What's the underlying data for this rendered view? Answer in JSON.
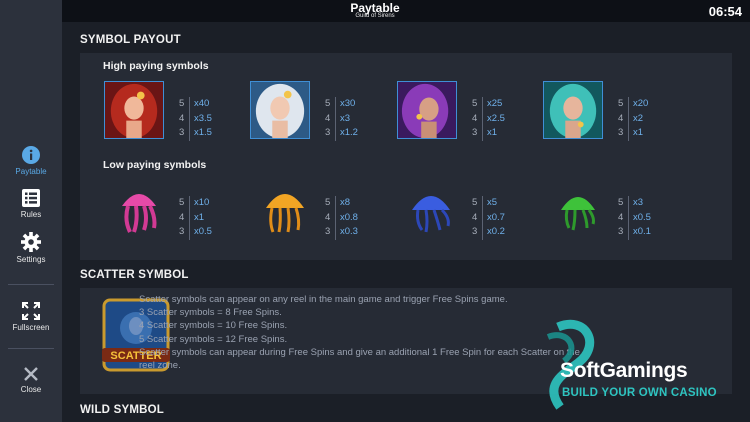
{
  "header": {
    "title": "Paytable",
    "subtitle": "Guild of Sirens",
    "clock": "06:54"
  },
  "sidebar": {
    "items": [
      {
        "label": "Paytable",
        "icon": "info-icon",
        "active": true
      },
      {
        "label": "Rules",
        "icon": "list-icon",
        "active": false
      },
      {
        "label": "Settings",
        "icon": "gear-icon",
        "active": false
      },
      {
        "label": "Fullscreen",
        "icon": "fullscreen-icon",
        "active": false
      },
      {
        "label": "Close",
        "icon": "close-icon",
        "active": false
      }
    ]
  },
  "symbol_payout": {
    "title": "SYMBOL PAYOUT",
    "high_title": "High paying symbols",
    "low_title": "Low paying symbols",
    "high": [
      {
        "icon": "red-siren-icon",
        "pays": [
          {
            "count": "5",
            "value": "x40"
          },
          {
            "count": "4",
            "value": "x3.5"
          },
          {
            "count": "3",
            "value": "x1.5"
          }
        ]
      },
      {
        "icon": "white-siren-icon",
        "pays": [
          {
            "count": "5",
            "value": "x30"
          },
          {
            "count": "4",
            "value": "x3"
          },
          {
            "count": "3",
            "value": "x1.2"
          }
        ]
      },
      {
        "icon": "purple-siren-icon",
        "pays": [
          {
            "count": "5",
            "value": "x25"
          },
          {
            "count": "4",
            "value": "x2.5"
          },
          {
            "count": "3",
            "value": "x1"
          }
        ]
      },
      {
        "icon": "teal-siren-icon",
        "pays": [
          {
            "count": "5",
            "value": "x20"
          },
          {
            "count": "4",
            "value": "x2"
          },
          {
            "count": "3",
            "value": "x1"
          }
        ]
      }
    ],
    "low": [
      {
        "icon": "pink-jellyfish-icon",
        "pays": [
          {
            "count": "5",
            "value": "x10"
          },
          {
            "count": "4",
            "value": "x1"
          },
          {
            "count": "3",
            "value": "x0.5"
          }
        ]
      },
      {
        "icon": "orange-jellyfish-icon",
        "pays": [
          {
            "count": "5",
            "value": "x8"
          },
          {
            "count": "4",
            "value": "x0.8"
          },
          {
            "count": "3",
            "value": "x0.3"
          }
        ]
      },
      {
        "icon": "blue-jellyfish-icon",
        "pays": [
          {
            "count": "5",
            "value": "x5"
          },
          {
            "count": "4",
            "value": "x0.7"
          },
          {
            "count": "3",
            "value": "x0.2"
          }
        ]
      },
      {
        "icon": "green-jellyfish-icon",
        "pays": [
          {
            "count": "5",
            "value": "x3"
          },
          {
            "count": "4",
            "value": "x0.5"
          },
          {
            "count": "3",
            "value": "x0.1"
          }
        ]
      }
    ]
  },
  "scatter": {
    "title": "SCATTER SYMBOL",
    "icon": "scatter-symbol-icon",
    "icon_label": "SCATTER",
    "lines": [
      "Scatter symbols can appear on any reel in the main game and trigger Free Spins game.",
      "3 Scatter symbols = 8 Free Spins.",
      "4 Scatter symbols = 10 Free Spins.",
      "5 Scatter symbols = 12 Free Spins.",
      "Scatter symbols can appear during Free Spins and give an additional 1 Free Spin for each Scatter on the",
      "reel zone."
    ]
  },
  "wild": {
    "title": "WILD SYMBOL"
  },
  "watermark": {
    "name": "SoftGamings",
    "tagline": "BUILD YOUR OWN CASINO",
    "icon": "softgamings-logo-icon"
  }
}
